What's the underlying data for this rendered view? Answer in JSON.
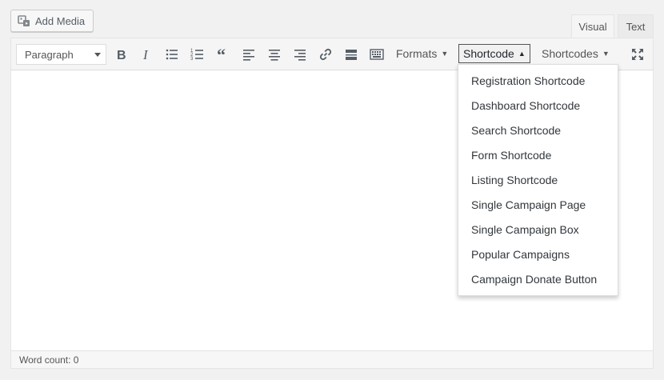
{
  "add_media": {
    "label": "Add Media"
  },
  "tabs": [
    {
      "label": "Visual"
    },
    {
      "label": "Text"
    }
  ],
  "toolbar": {
    "format_select": "Paragraph",
    "formats_label": "Formats",
    "shortcode_label": "Shortcode",
    "shortcodes_label": "Shortcodes",
    "icons": [
      "bold-icon",
      "italic-icon",
      "bulleted-list-icon",
      "numbered-list-icon",
      "blockquote-icon",
      "align-left-icon",
      "align-center-icon",
      "align-right-icon",
      "link-icon",
      "read-more-icon",
      "toolbar-toggle-icon",
      "fullscreen-icon"
    ]
  },
  "dropdown": {
    "items": [
      "Registration Shortcode",
      "Dashboard Shortcode",
      "Search Shortcode",
      "Form Shortcode",
      "Listing Shortcode",
      "Single Campaign Page",
      "Single Campaign Box",
      "Popular Campaigns",
      "Campaign Donate Button"
    ]
  },
  "status": {
    "word_count": "Word count: 0"
  },
  "colors": {
    "icon": "#555d66",
    "toolbar_bg": "#f5f5f5",
    "background": "#f1f1f1"
  }
}
